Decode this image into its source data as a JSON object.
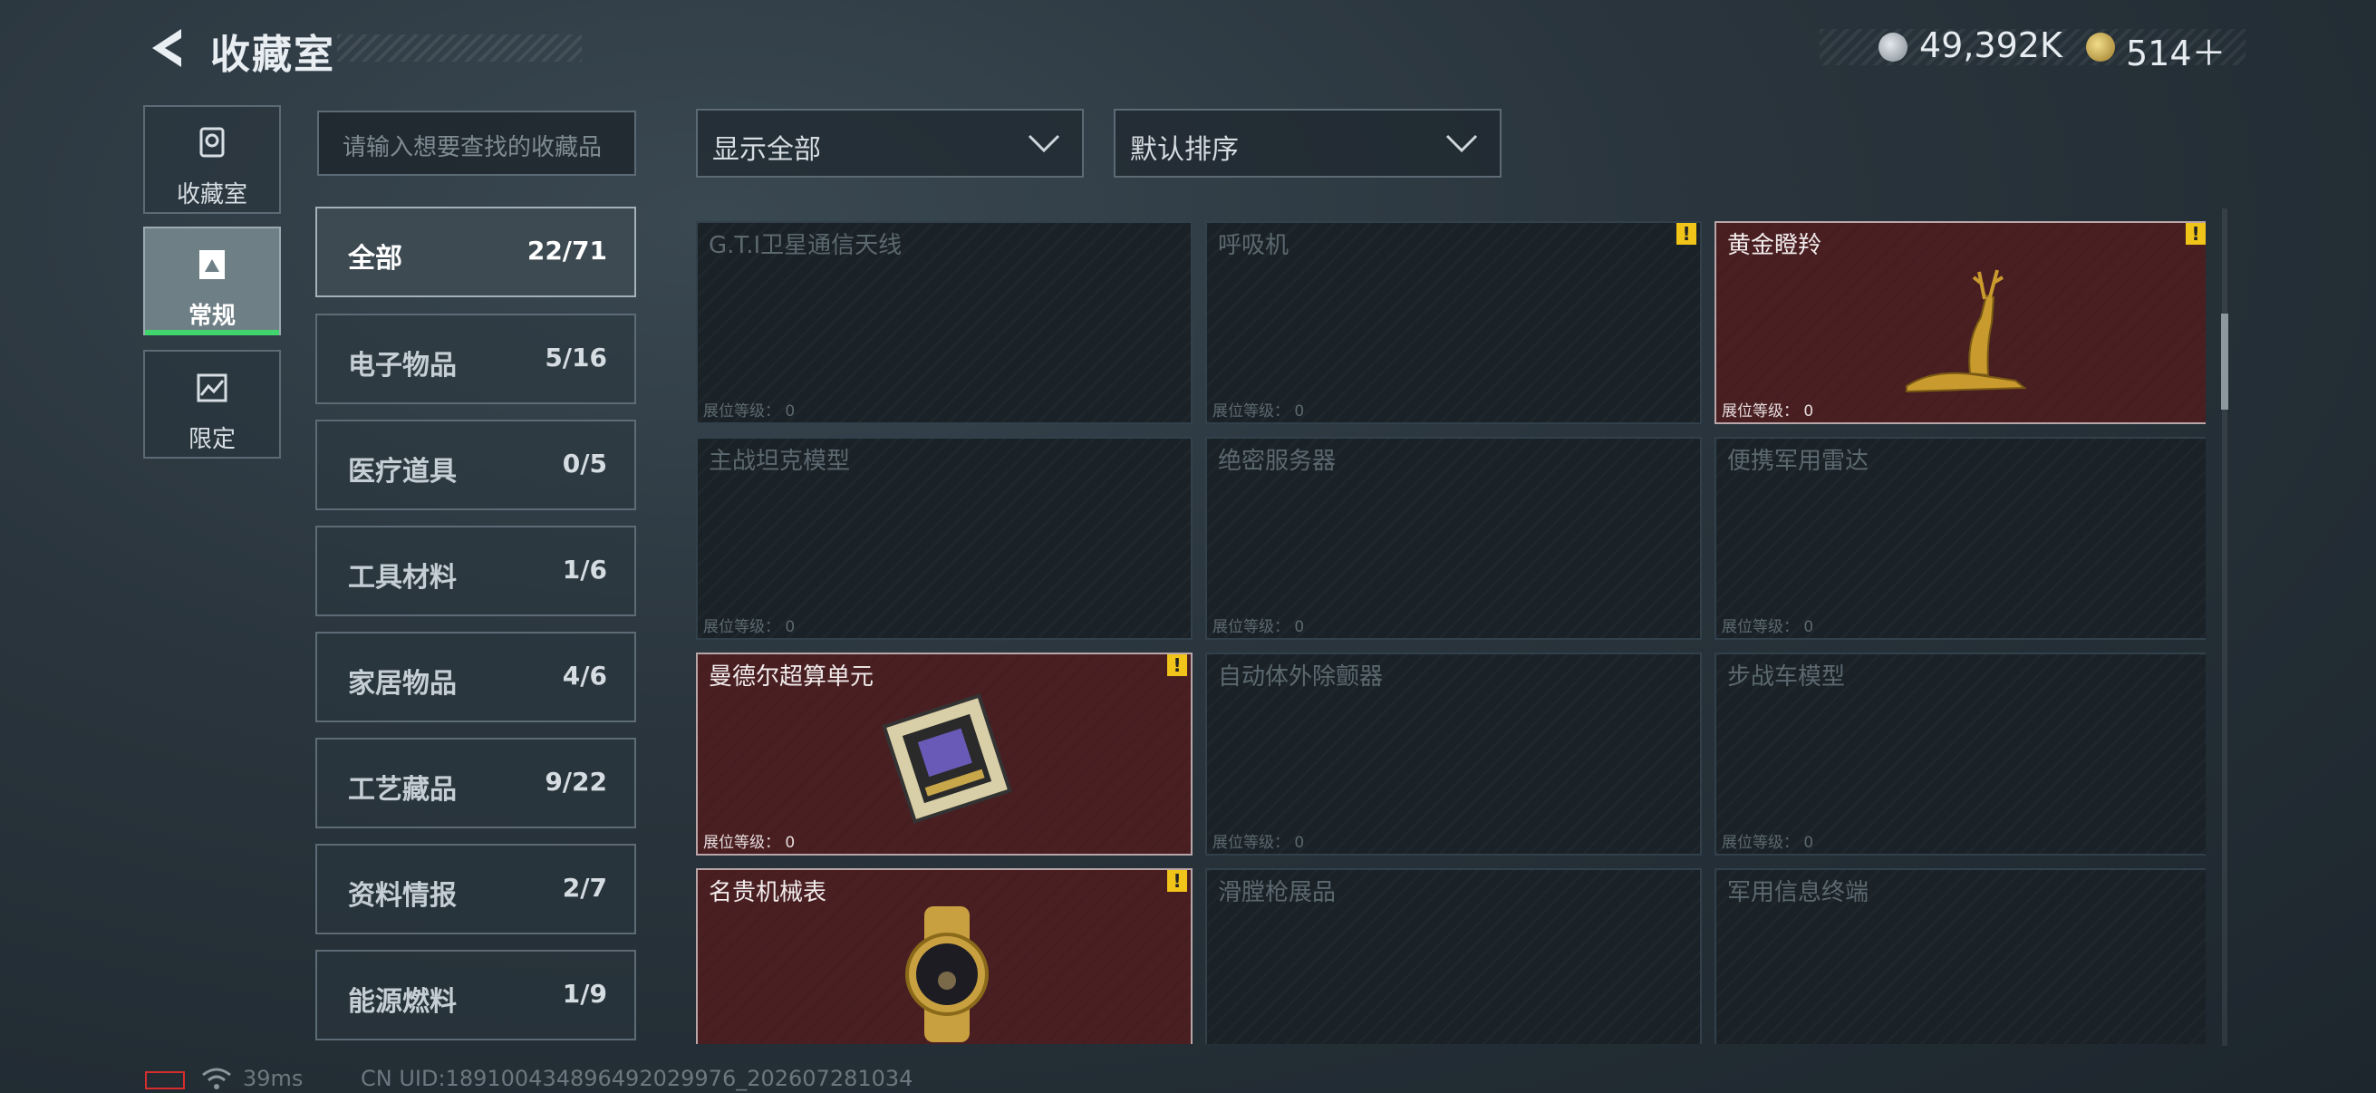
{
  "header": {
    "title": "收藏室",
    "currency_1": "49,392K",
    "currency_2": "514＋"
  },
  "side_tabs": [
    {
      "label": "收藏室",
      "icon": "trophy-icon",
      "active": false
    },
    {
      "label": "常规",
      "icon": "document-icon",
      "active": true
    },
    {
      "label": "限定",
      "icon": "image-icon",
      "active": false
    }
  ],
  "search": {
    "placeholder": "请输入想要查找的收藏品"
  },
  "categories": [
    {
      "name": "全部",
      "count": "22/71",
      "active": true
    },
    {
      "name": "电子物品",
      "count": "5/16"
    },
    {
      "name": "医疗道具",
      "count": "0/5"
    },
    {
      "name": "工具材料",
      "count": "1/6"
    },
    {
      "name": "家居物品",
      "count": "4/6"
    },
    {
      "name": "工艺藏品",
      "count": "9/22"
    },
    {
      "name": "资料情报",
      "count": "2/7"
    },
    {
      "name": "能源燃料",
      "count": "1/9"
    }
  ],
  "filters": {
    "display": "显示全部",
    "sort": "默认排序"
  },
  "level_label": "展位等级：",
  "items": [
    {
      "name": "G.T.I卫星通信天线",
      "level": "0",
      "owned": false,
      "alert": false
    },
    {
      "name": "呼吸机",
      "level": "0",
      "owned": false,
      "alert": true
    },
    {
      "name": "黄金瞪羚",
      "level": "0",
      "owned": true,
      "alert": true,
      "art": "gazelle"
    },
    {
      "name": "主战坦克模型",
      "level": "0",
      "owned": false,
      "alert": false
    },
    {
      "name": "绝密服务器",
      "level": "0",
      "owned": false,
      "alert": false
    },
    {
      "name": "便携军用雷达",
      "level": "0",
      "owned": false,
      "alert": false
    },
    {
      "name": "曼德尔超算单元",
      "level": "0",
      "owned": true,
      "alert": true,
      "art": "chip"
    },
    {
      "name": "自动体外除颤器",
      "level": "0",
      "owned": false,
      "alert": false
    },
    {
      "name": "步战车模型",
      "level": "0",
      "owned": false,
      "alert": false
    },
    {
      "name": "名贵机械表",
      "level": "",
      "owned": true,
      "alert": true,
      "art": "watch"
    },
    {
      "name": "滑膛枪展品",
      "level": "",
      "owned": false,
      "alert": false
    },
    {
      "name": "军用信息终端",
      "level": "",
      "owned": false,
      "alert": false
    }
  ],
  "footer": {
    "ping": "39ms",
    "uid": "CN UID:18910043489649202997​6_202607281034"
  },
  "colors": {
    "owned_card": "#4a1f22",
    "active_tab_bar": "#40d36e",
    "alert": "#f0c419"
  }
}
